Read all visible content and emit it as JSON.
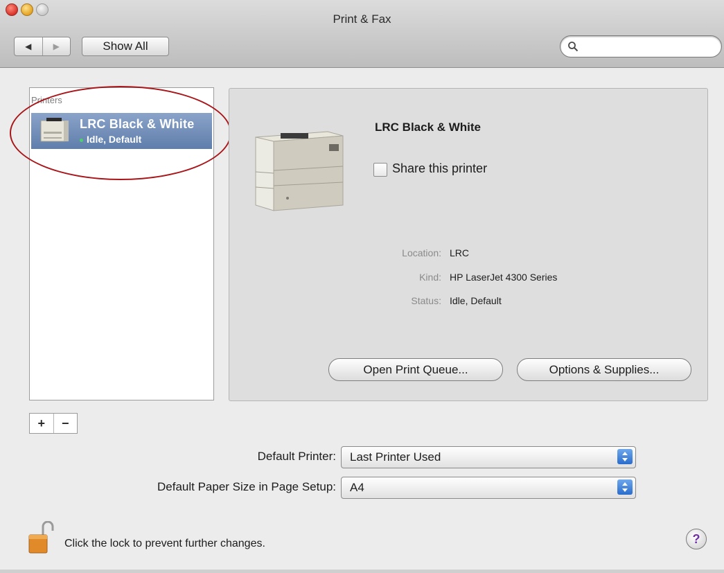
{
  "window": {
    "title": "Print & Fax"
  },
  "toolbar": {
    "back_label": "◀",
    "forward_label": "▶",
    "show_all_label": "Show All",
    "search": {
      "value": "",
      "placeholder": ""
    }
  },
  "printers": {
    "header": "Printers",
    "items": [
      {
        "name": "LRC Black & White",
        "status": "Idle, Default"
      }
    ],
    "add_label": "+",
    "remove_label": "−"
  },
  "details": {
    "name": "LRC Black & White",
    "share_label": "Share this printer",
    "share_checked": false,
    "location_label": "Location:",
    "location_value": "LRC",
    "kind_label": "Kind:",
    "kind_value": "HP LaserJet 4300 Series",
    "status_label": "Status:",
    "status_value": "Idle, Default",
    "open_queue_label": "Open Print Queue...",
    "options_label": "Options & Supplies..."
  },
  "settings": {
    "default_printer_label": "Default Printer:",
    "default_printer_value": "Last Printer Used",
    "paper_size_label": "Default Paper Size in Page Setup:",
    "paper_size_value": "A4"
  },
  "footer": {
    "lock_text": "Click the lock to prevent further changes.",
    "help_label": "?"
  },
  "colors": {
    "selection": "#6f8cb8",
    "annotation_circle": "#a8161a",
    "status_dot": "#4bd26a",
    "popup_arrows": "#2a6ccc"
  }
}
